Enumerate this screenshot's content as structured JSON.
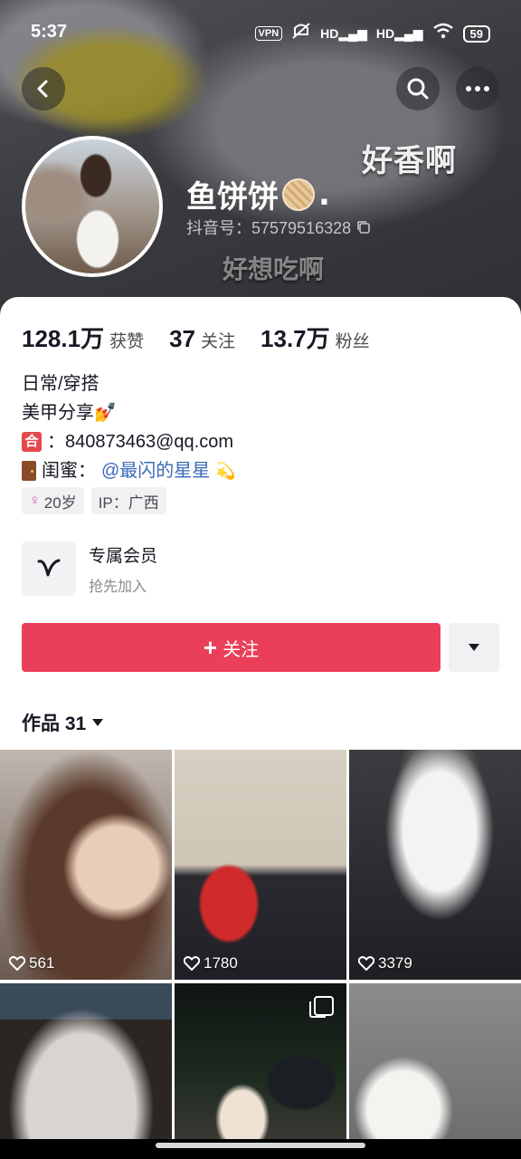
{
  "status_bar": {
    "time": "5:37",
    "vpn": "VPN",
    "signal1": "HD",
    "signal2": "HD",
    "battery": "59"
  },
  "banner": {
    "caption_top": "好香啊",
    "caption_bottom": "好想吃啊"
  },
  "profile": {
    "display_name": "鱼饼饼",
    "name_suffix": ".",
    "douyin_id": "抖音号：57579516328"
  },
  "stats": [
    {
      "value": "128.1万",
      "label": "获赞"
    },
    {
      "value": "37",
      "label": "关注"
    },
    {
      "value": "13.7万",
      "label": "粉丝"
    }
  ],
  "bio": {
    "line1": "日常/穿搭",
    "line2": "美甲分享💅",
    "line3_icon": "合",
    "line3_text": "：840873463@qq.com",
    "line4_prefix": "闺蜜：",
    "line4_mention": "@最闪的星星",
    "line4_emoji": "💫"
  },
  "chips": {
    "age": "20岁",
    "ip": "IP：广西"
  },
  "membership": {
    "title": "专属会员",
    "subtitle": "抢先加入"
  },
  "follow_button": "关注",
  "works": {
    "label": "作品 31"
  },
  "videos": [
    {
      "likes": "561"
    },
    {
      "likes": "1780"
    },
    {
      "likes": "3379"
    },
    {
      "likes": ""
    },
    {
      "likes": ""
    },
    {
      "likes": ""
    }
  ],
  "colors": {
    "follow": "#ea3f59",
    "mention": "#3b6ab8",
    "text": "#161823"
  }
}
